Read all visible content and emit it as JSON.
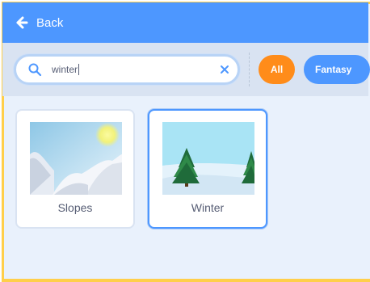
{
  "header": {
    "back_label": "Back",
    "back_icon": "arrow-left-icon"
  },
  "search": {
    "query": "winter",
    "search_icon": "magnifier-icon",
    "clear_icon": "close-icon"
  },
  "filters": [
    {
      "label": "All",
      "active": true,
      "color": "#ff8c1a"
    },
    {
      "label": "Fantasy",
      "active": false,
      "color": "#4d97ff"
    }
  ],
  "backdrops": [
    {
      "name": "Slopes",
      "selected": false
    },
    {
      "name": "Winter",
      "selected": true
    }
  ],
  "colors": {
    "header": "#4d97ff",
    "frame": "#ffcf4a",
    "accent": "#ff8c1a"
  }
}
